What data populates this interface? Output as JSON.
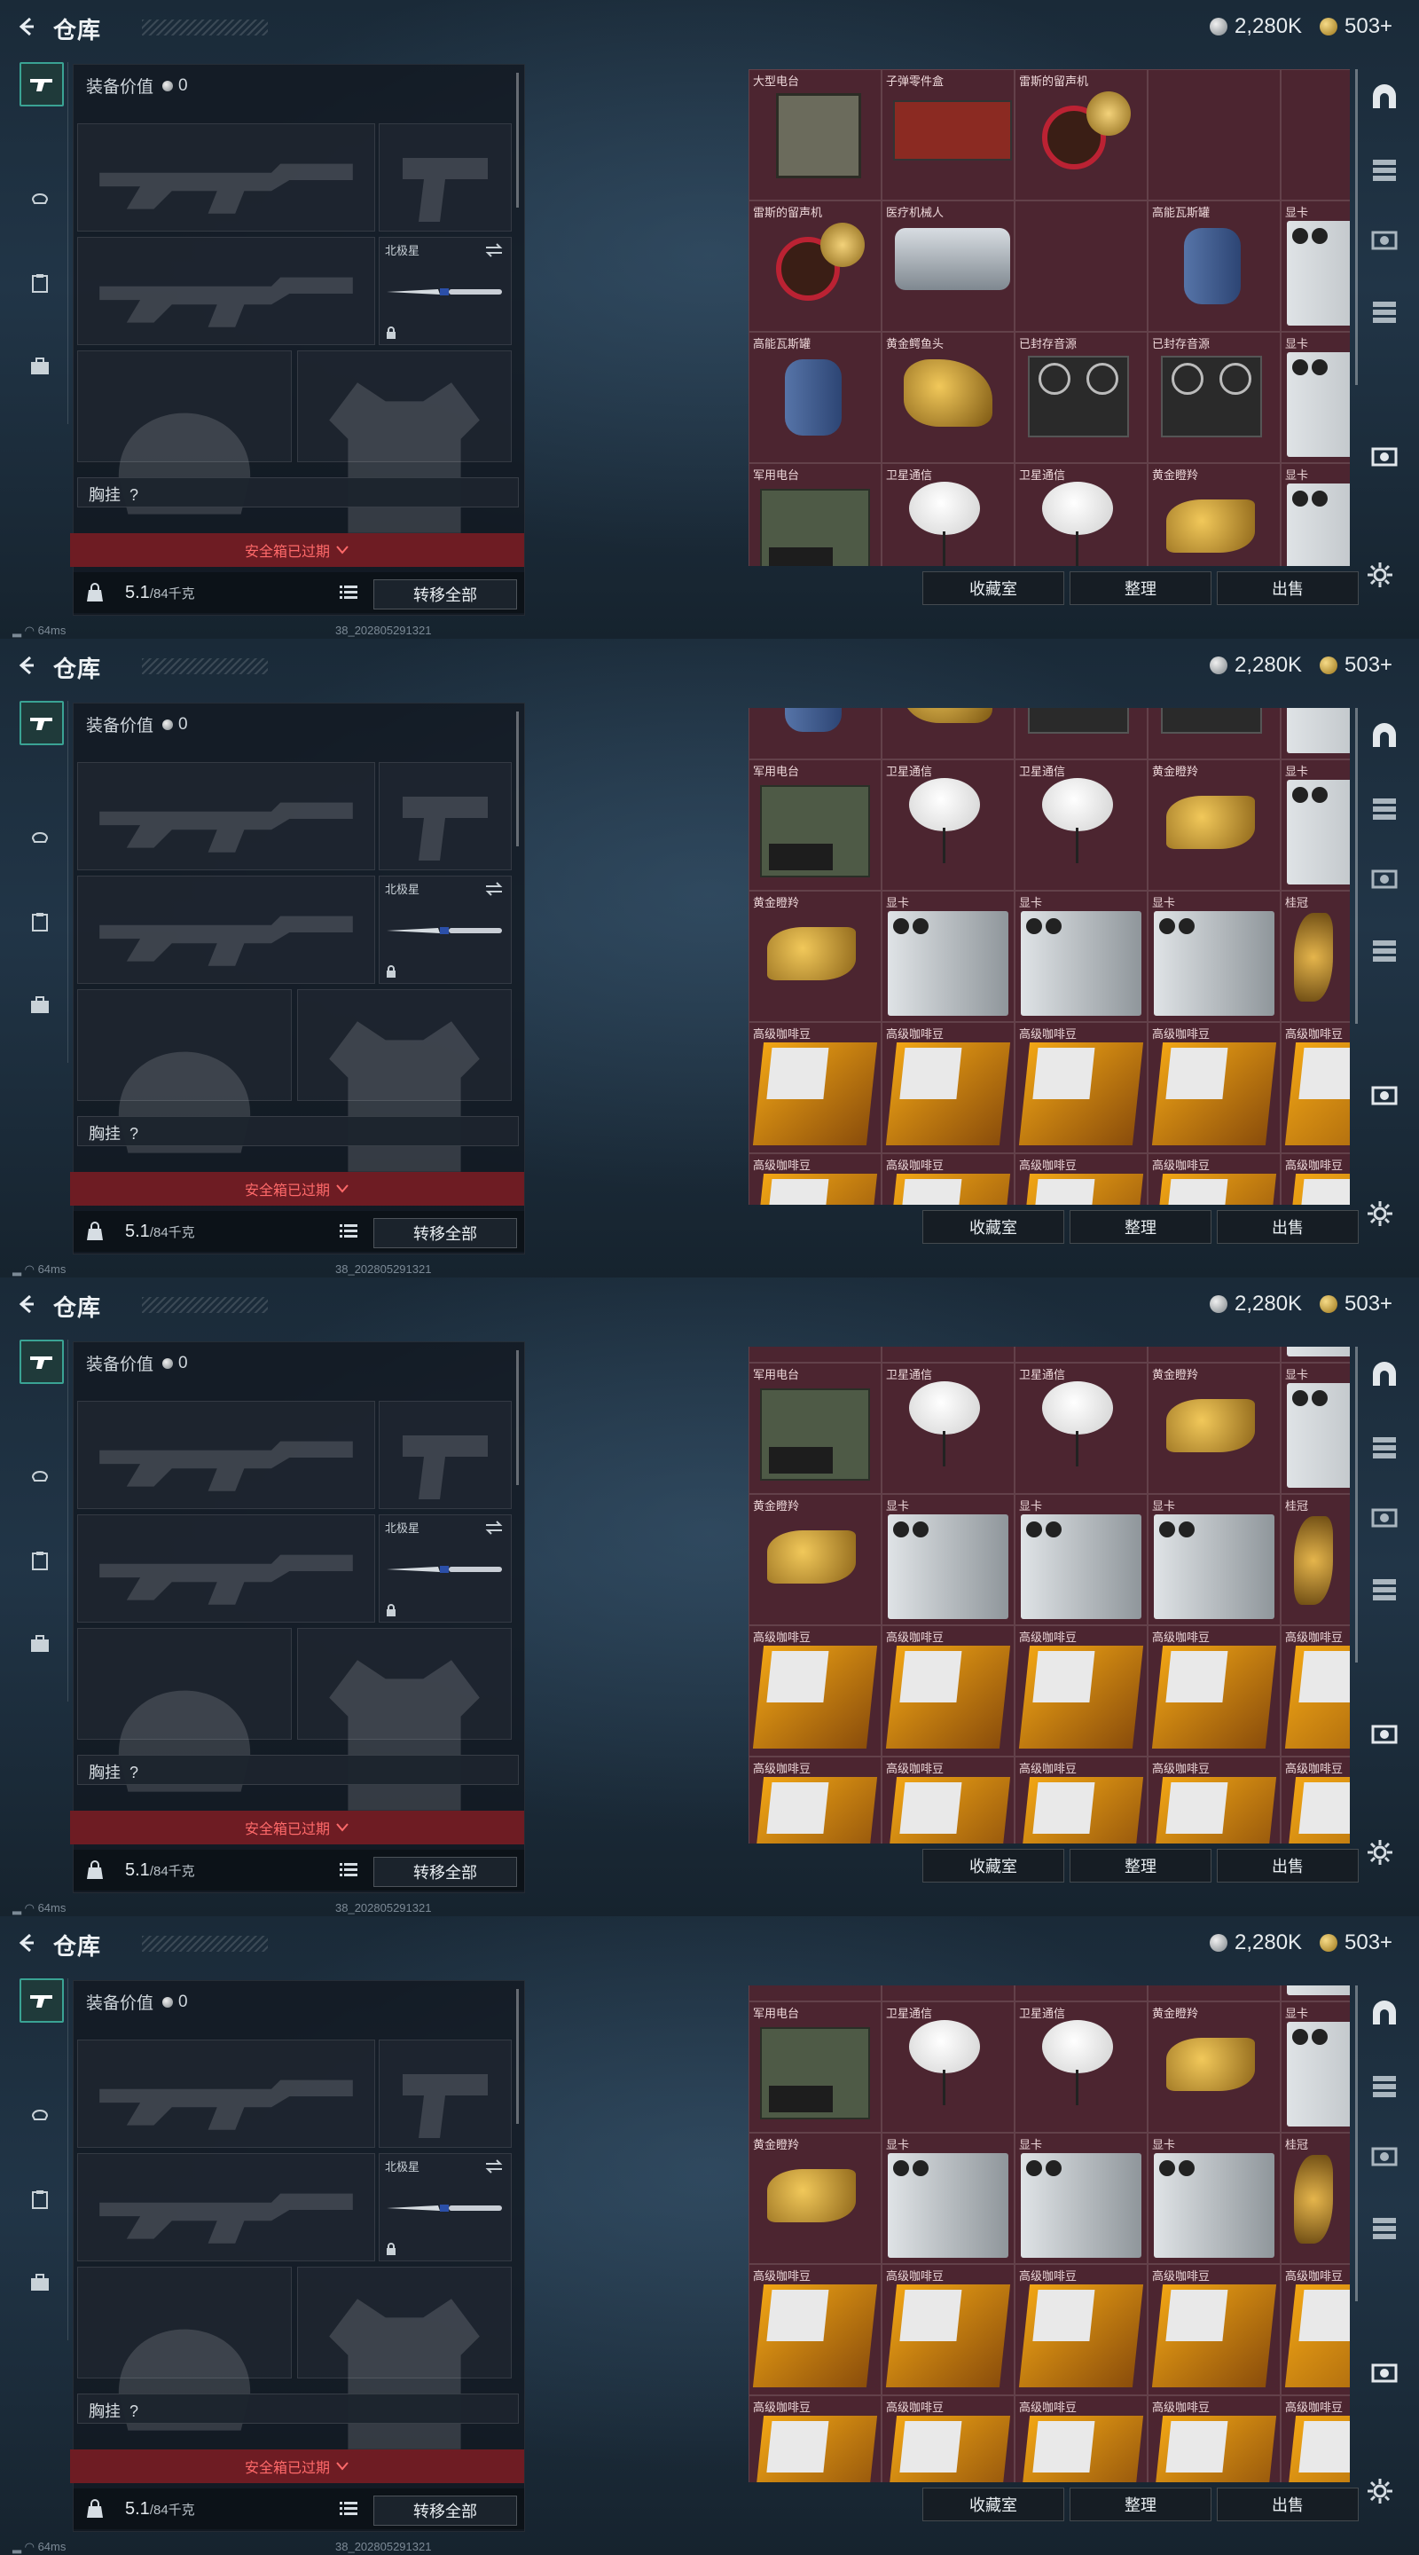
{
  "header": {
    "title": "仓库",
    "silver": "2,280K",
    "gold": "503+"
  },
  "equipment": {
    "value_label": "装备价值",
    "value": "0",
    "slot_pistol_name": "北极星",
    "chest_label": "胸挂",
    "chest_value": "?",
    "safebox_text": "安全箱已过期",
    "weight": "5.1",
    "weight_capacity": "/84千克",
    "transfer_all": "转移全部"
  },
  "status": {
    "ping": "64ms",
    "build": "38_20280529132​1"
  },
  "bottom_buttons": {
    "collection": "收藏室",
    "sort": "整理",
    "sell": "出售"
  },
  "shots": [
    {
      "rows": [
        [
          "大型电台",
          "子弹零件盒",
          "雷斯的留声机",
          "",
          "",
          "显卡"
        ],
        [
          "雷斯的留声机",
          "医疗机械人",
          "",
          "高能瓦斯罐",
          "",
          ""
        ],
        [
          "高能瓦斯罐",
          "黄金鳄鱼头",
          "已封存音源",
          "已封存音源",
          "显卡",
          ""
        ],
        [
          "军用电台",
          "卫星通信",
          "卫星通信",
          "黄金瞪羚",
          "显卡",
          ""
        ]
      ]
    }
  ],
  "grid_labels": {
    "radio": "军用电台",
    "satellite": "卫星通信",
    "gazelle": "黄金瞪羚",
    "gpu": "显卡",
    "crown": "桂冠",
    "coffee": "高级咖啡豆"
  },
  "colors": {
    "cell_bg": "#4c2530",
    "accent_teal": "#3aa394",
    "safebox_red": "#6e1c23"
  }
}
